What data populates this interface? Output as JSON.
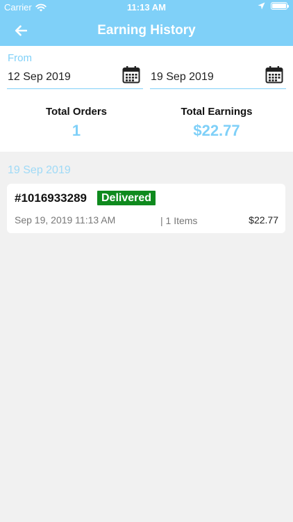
{
  "status_bar": {
    "carrier": "Carrier",
    "time": "11:13 AM"
  },
  "header": {
    "title": "Earning History",
    "back_icon": "arrow-left-icon"
  },
  "filters": {
    "from_label": "From",
    "from_date": "12 Sep 2019",
    "to_date": "19 Sep 2019",
    "calendar_icon": "calendar-icon"
  },
  "summary": {
    "orders_label": "Total Orders",
    "orders_value": "1",
    "earnings_label": "Total Earnings",
    "earnings_value": "$22.77"
  },
  "orders_section": {
    "date_heading": "19 Sep 2019",
    "orders": [
      {
        "id": "#1016933289",
        "status": "Delivered",
        "datetime": "Sep 19, 2019 11:13 AM",
        "items": "| 1 Items",
        "amount": "$22.77"
      }
    ]
  },
  "colors": {
    "accent": "#7fd0f8",
    "status_delivered": "#0f8a1e",
    "background": "#f1f1f1"
  }
}
